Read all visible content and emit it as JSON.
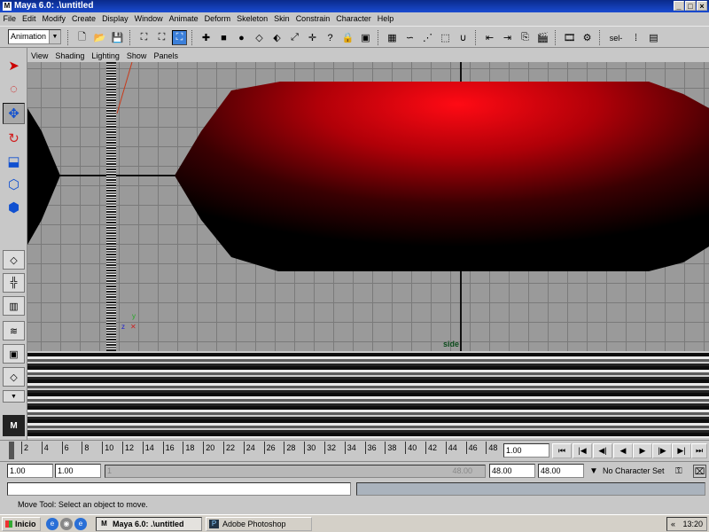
{
  "window": {
    "title": "Maya 6.0: .\\untitled",
    "app_icon": "maya-app-icon",
    "controls": [
      "_",
      "□",
      "×"
    ]
  },
  "menubar": [
    "File",
    "Edit",
    "Modify",
    "Create",
    "Display",
    "Window",
    "Animate",
    "Deform",
    "Skeleton",
    "Skin",
    "Constrain",
    "Character",
    "Help"
  ],
  "toolbar": {
    "menu_set": "Animation",
    "sel_label": "sel-"
  },
  "viewport": {
    "menus": [
      "View",
      "Shading",
      "Lighting",
      "Show",
      "Panels"
    ],
    "camera_label": "side",
    "axis_y": "y",
    "axis_z": "z",
    "object_color": "#ff0a14"
  },
  "timeslider": {
    "ticks": [
      "2",
      "4",
      "6",
      "8",
      "10",
      "12",
      "14",
      "16",
      "18",
      "20",
      "22",
      "24",
      "26",
      "28",
      "30",
      "32",
      "34",
      "36",
      "38",
      "40",
      "42",
      "44",
      "46",
      "48"
    ],
    "current_frame": "1.00"
  },
  "rangeslider": {
    "start_time": "1.00",
    "playback_start": "1.00",
    "track_start": "1",
    "track_end": "48.00",
    "playback_end": "48.00",
    "end_time": "48.00",
    "character_set": "No Character Set"
  },
  "commandline": {
    "input": "",
    "result": ""
  },
  "helpline": {
    "text": "Move Tool: Select an object to move."
  },
  "taskbar": {
    "start": "Inicio",
    "tasks": [
      {
        "label": "Maya 6.0: .\\untitled",
        "active": true
      },
      {
        "label": "Adobe Photoshop",
        "active": false
      }
    ],
    "tray_chevron": "«",
    "clock": "13:20"
  }
}
